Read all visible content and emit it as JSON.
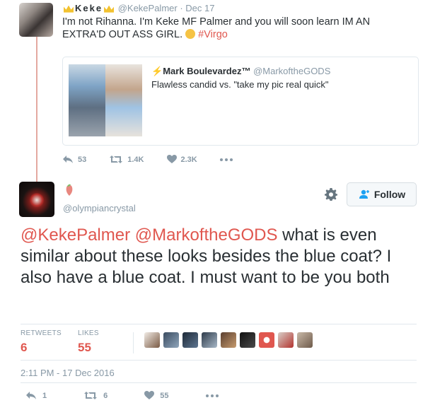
{
  "tweet1": {
    "name": "Keke",
    "handle": "@KekePalmer",
    "date": "· Dec 17",
    "text": "I'm not Rihanna. I'm Keke MF Palmer and you will soon learn IM AN EXTRA'D OUT ASS GIRL. ",
    "hashtag": "#Virgo",
    "quote": {
      "name": "Mark Boulevardez™",
      "handle": "@MarkoftheGODS",
      "text": "Flawless candid vs. \"take my pic real quick\""
    },
    "actions": {
      "replies": "53",
      "retweets": "1.4K",
      "likes": "2.3K"
    }
  },
  "tweet2": {
    "handle": "@olympiancrystal",
    "follow_label": "Follow",
    "mention1": "@KekePalmer",
    "mention2": "@MarkoftheGODS",
    "text": " what is even similar about these looks besides the blue coat? I also have a blue coat. I must want to be you both",
    "stats": {
      "retweets_label": "RETWEETS",
      "retweets_value": "6",
      "likes_label": "LIKES",
      "likes_value": "55"
    },
    "timestamp": "2:11 PM - 17 Dec 2016",
    "actions": {
      "replies": "1",
      "retweets": "6",
      "likes": "55"
    }
  },
  "colors": {
    "accent": "#e0574f",
    "muted": "#8899a6",
    "thread_line": "#e4a9a1"
  },
  "icons": [
    "reply-icon",
    "retweet-icon",
    "heart-icon",
    "more-icon",
    "gear-icon",
    "follow-plus-icon",
    "crown-icon",
    "lightning-icon"
  ]
}
